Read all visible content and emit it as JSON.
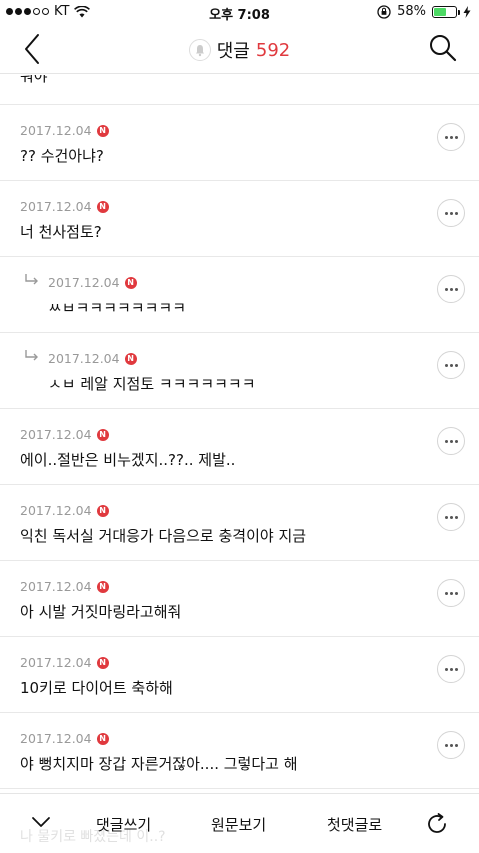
{
  "status_bar": {
    "carrier": "KT",
    "time": "오후 7:08",
    "battery": "58%",
    "battery_level": 0.58
  },
  "header": {
    "title": "댓글",
    "count": "592"
  },
  "comments_partial_top": "줘야",
  "comments": [
    {
      "date": "2017.12.04",
      "badge": "N",
      "text": "?? 수건아냐?",
      "reply": false
    },
    {
      "date": "2017.12.04",
      "badge": "N",
      "text": "너 천사점토?",
      "reply": false
    },
    {
      "date": "2017.12.04",
      "badge": "N",
      "text": "ㅆㅂㅋㅋㅋㅋㅋㅋㅋㅋ",
      "reply": true
    },
    {
      "date": "2017.12.04",
      "badge": "N",
      "text": "ㅅㅂ 레알 지점토 ㅋㅋㅋㅋㅋㅋㅋ",
      "reply": true
    },
    {
      "date": "2017.12.04",
      "badge": "N",
      "text": "에이..절반은 비누겠지..??.. 제발..",
      "reply": false
    },
    {
      "date": "2017.12.04",
      "badge": "N",
      "text": "익친 독서실 거대응가 다음으로 충격이야 지금",
      "reply": false
    },
    {
      "date": "2017.12.04",
      "badge": "N",
      "text": "아 시발 거짓마링라고해줘",
      "reply": false
    },
    {
      "date": "2017.12.04",
      "badge": "N",
      "text": "10키로 다이어트 축하해",
      "reply": false
    },
    {
      "date": "2017.12.04",
      "badge": "N",
      "text": "야 뻥치지마 장갑 자른거잖아.... 그렇다고 해",
      "reply": false
    }
  ],
  "bottom_bar": {
    "write": "댓글쓰기",
    "view_original": "원문보기",
    "first_comment": "첫댓글로",
    "ghost": "나 물키로 빠졌는데 이..?"
  },
  "icons": {
    "back": "chevron-left-icon",
    "bell": "bell-icon",
    "search": "search-icon",
    "more": "more-horizontal-icon",
    "reply": "reply-arrow-icon",
    "collapse": "chevron-down-icon",
    "refresh": "refresh-icon"
  },
  "colors": {
    "accent": "#e0393e",
    "battery": "#4cd964",
    "meta": "#999999"
  }
}
